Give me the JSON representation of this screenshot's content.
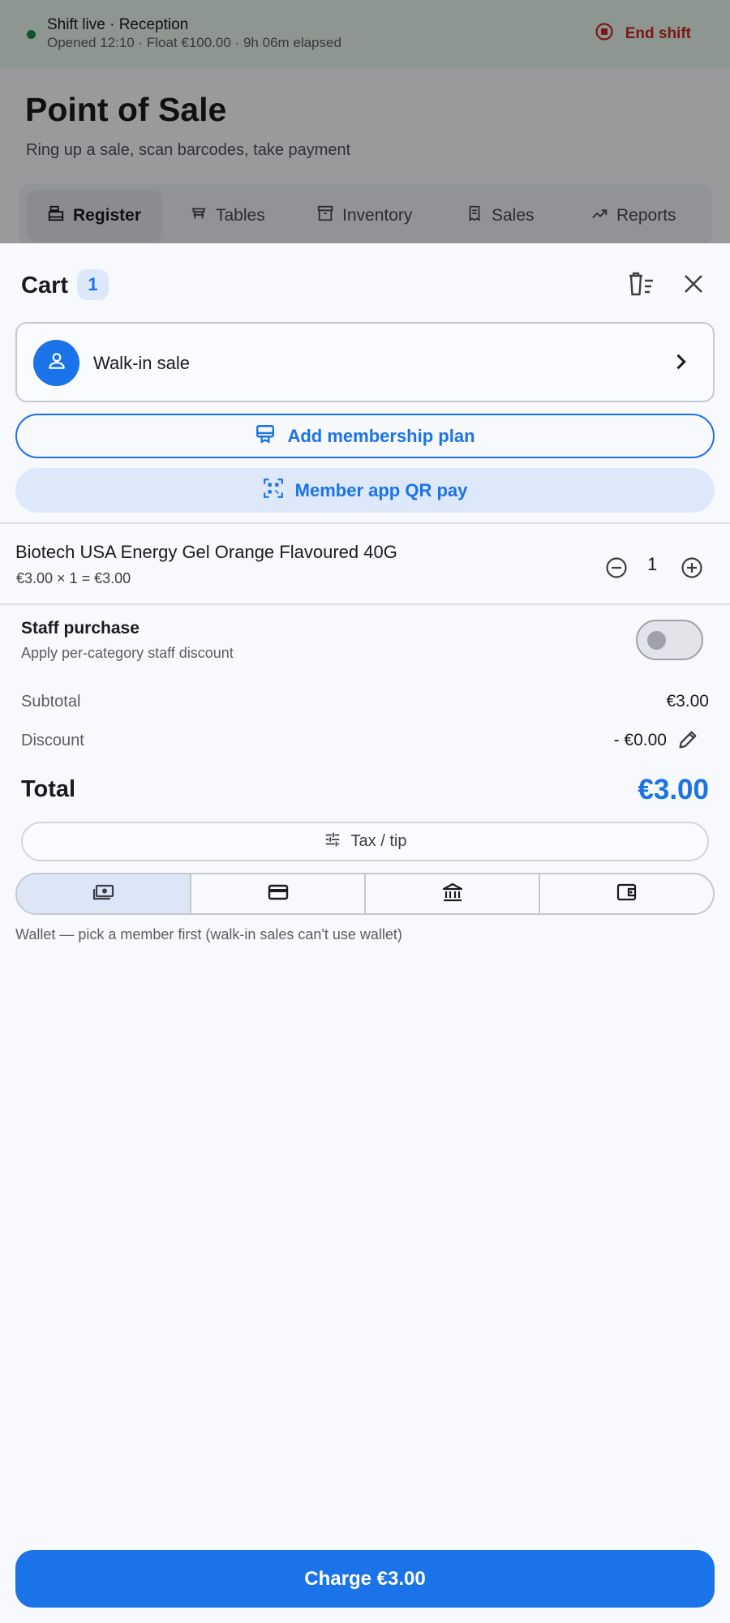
{
  "shift": {
    "title": "Shift live · Reception",
    "subtitle": "Opened 12:10 · Float €100.00 · 9h 06m elapsed",
    "end_label": "End shift"
  },
  "page": {
    "title": "Point of Sale",
    "subtitle": "Ring up a sale, scan barcodes, take payment"
  },
  "tabs": [
    {
      "label": "Register",
      "icon": "register-icon",
      "active": true
    },
    {
      "label": "Tables",
      "icon": "table-icon",
      "active": false
    },
    {
      "label": "Inventory",
      "icon": "inventory-icon",
      "active": false
    },
    {
      "label": "Sales",
      "icon": "receipt-icon",
      "active": false
    },
    {
      "label": "Reports",
      "icon": "trending-icon",
      "active": false
    }
  ],
  "cart": {
    "title": "Cart",
    "count": "1",
    "customer": "Walk-in sale",
    "add_membership_label": "Add membership plan",
    "qr_pay_label": "Member app QR pay",
    "items": [
      {
        "name": "Biotech USA Energy Gel Orange Flavoured 40G",
        "calc": "€3.00 × 1 = €3.00",
        "qty": "1"
      }
    ],
    "staff_purchase": {
      "title": "Staff purchase",
      "subtitle": "Apply per-category staff discount",
      "enabled": false
    },
    "subtotal_label": "Subtotal",
    "subtotal_value": "€3.00",
    "discount_label": "Discount",
    "discount_value": "- €0.00",
    "total_label": "Total",
    "total_value": "€3.00",
    "tax_tip_label": "Tax / tip",
    "payment_methods": [
      {
        "icon": "cash-icon",
        "selected": true
      },
      {
        "icon": "card-icon",
        "selected": false
      },
      {
        "icon": "bank-icon",
        "selected": false
      },
      {
        "icon": "wallet-icon",
        "selected": false
      }
    ],
    "wallet_note": "Wallet — pick a member first (walk-in sales can't use wallet)",
    "charge_label": "Charge €3.00"
  },
  "colors": {
    "primary": "#1a73e8",
    "danger": "#c62828",
    "live": "#1f8a4c"
  }
}
